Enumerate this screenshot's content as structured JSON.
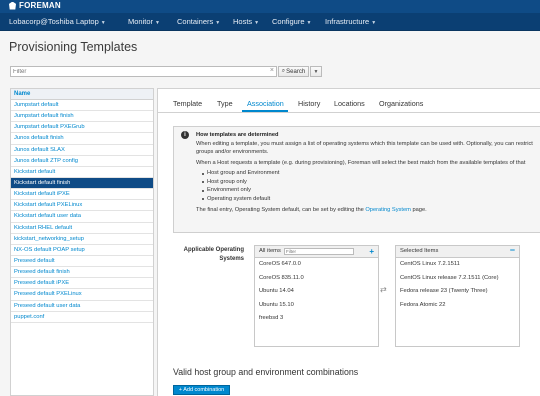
{
  "app": {
    "brand": "FOREMAN"
  },
  "nav": {
    "items": [
      {
        "label": "Lobacorp@Toshiba Laptop"
      },
      {
        "label": "Monitor"
      },
      {
        "label": "Containers"
      },
      {
        "label": "Hosts"
      },
      {
        "label": "Configure"
      },
      {
        "label": "Infrastructure"
      }
    ]
  },
  "page": {
    "title": "Provisioning Templates"
  },
  "search": {
    "placeholder": "Filter",
    "button_label": "Search"
  },
  "templates": {
    "header": "Name",
    "items": [
      "Jumpstart default",
      "Jumpstart default finish",
      "Jumpstart default PXEGrub",
      "Junos default finish",
      "Junos default SLAX",
      "Junos default ZTP config",
      "Kickstart default",
      "Kickstart default finish",
      "Kickstart default iPXE",
      "Kickstart default PXELinux",
      "Kickstart default user data",
      "Kickstart RHEL default",
      "kickstart_networking_setup",
      "NX-OS default POAP setup",
      "Preseed default",
      "Preseed default finish",
      "Preseed default iPXE",
      "Preseed default PXELinux",
      "Preseed default user data",
      "puppet.conf"
    ],
    "active_index": 7
  },
  "tabs": [
    {
      "label": "Template"
    },
    {
      "label": "Type"
    },
    {
      "label": "Association"
    },
    {
      "label": "History"
    },
    {
      "label": "Locations"
    },
    {
      "label": "Organizations"
    }
  ],
  "info": {
    "title": "How templates are determined",
    "line1": "When editing a template, you must assign a list of operating systems which this template can be used with. Optionally, you can restrict",
    "line2": "groups and/or environments.",
    "line3": "When a Host requests a template (e.g. during provisioning), Foreman will select the best match from the available templates of that",
    "bullets": [
      "Host group and Environment",
      "Host group only",
      "Environment only",
      "Operating system default"
    ],
    "final_prefix": "The final entry, Operating System default, can be set by editing the ",
    "final_link": "Operating System",
    "final_suffix": " page."
  },
  "os": {
    "label": "Applicable Operating Systems",
    "all_items_label": "All items",
    "filter_placeholder": "Filter",
    "available": [
      "CoreOS 647.0.0",
      "CoreOS 835.11.0",
      "Ubuntu 14.04",
      "Ubuntu 15.10",
      "freebsd 3"
    ],
    "selected_label": "Selected Items",
    "selected": [
      "CentOS Linux 7.2.1511",
      "CentOS Linux release 7.2.1511 (Core)",
      "Fedora release 23 (Twenty Three)",
      "Fedora Atomic 22"
    ]
  },
  "combinations": {
    "heading": "Valid host group and environment combinations",
    "add_button": "+ Add combination"
  },
  "colors": {
    "header": "#0f4b86",
    "nav": "#0b3f73",
    "accent": "#0088ce"
  }
}
